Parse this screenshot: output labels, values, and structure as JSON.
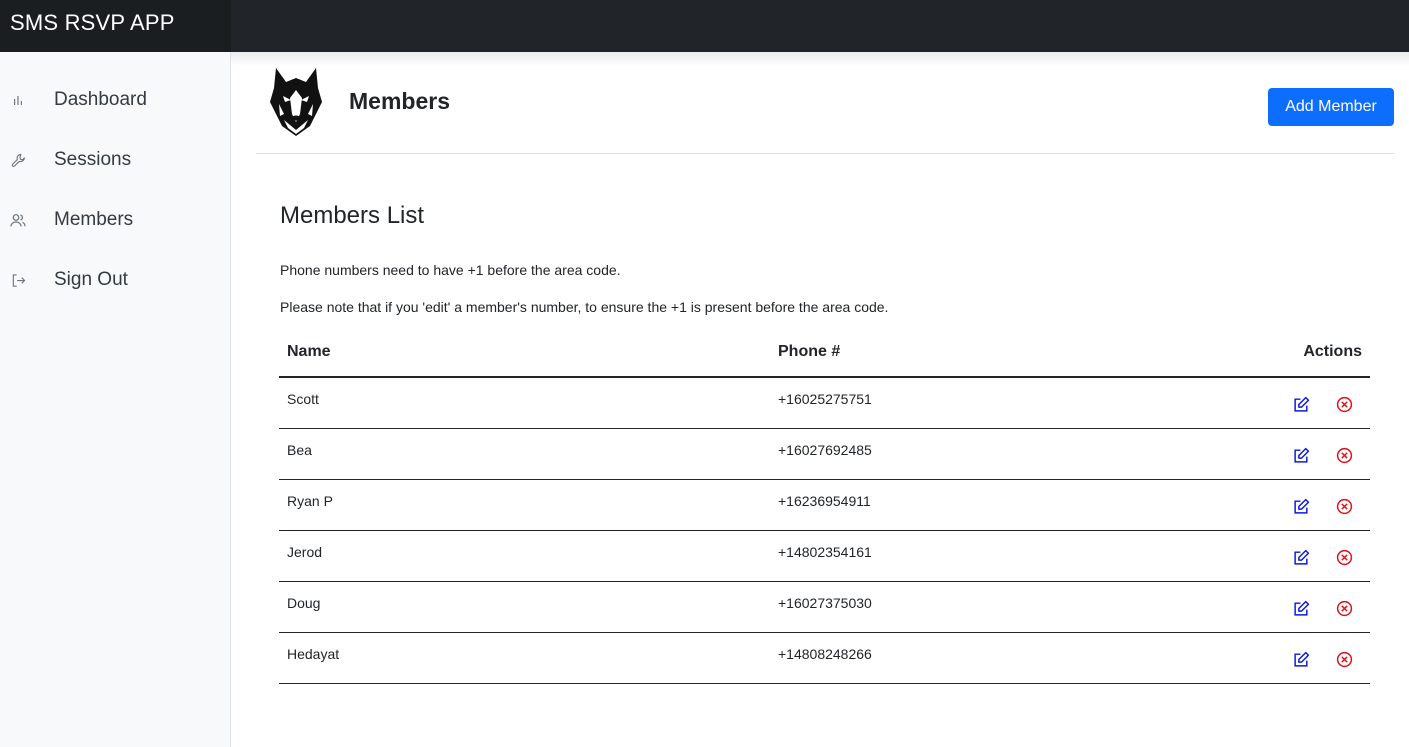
{
  "app": {
    "title": "SMS RSVP APP"
  },
  "sidebar": {
    "items": [
      {
        "label": "Dashboard",
        "icon": "bar-chart-icon"
      },
      {
        "label": "Sessions",
        "icon": "wrench-icon"
      },
      {
        "label": "Members",
        "icon": "users-icon"
      },
      {
        "label": "Sign Out",
        "icon": "sign-out-icon"
      }
    ]
  },
  "header": {
    "title": "Members",
    "add_button": "Add Member",
    "logo_icon": "wolf-logo-icon"
  },
  "main": {
    "section_title": "Members List",
    "notes": [
      "Phone numbers need to have +1 before the area code.",
      "Please note that if you 'edit' a member's number, to ensure the +1 is present before the area code."
    ],
    "table": {
      "columns": [
        "Name",
        "Phone #",
        "Actions"
      ],
      "rows": [
        {
          "name": "Scott",
          "phone": "+16025275751"
        },
        {
          "name": "Bea",
          "phone": "+16027692485"
        },
        {
          "name": "Ryan P",
          "phone": "+16236954911"
        },
        {
          "name": "Jerod",
          "phone": "+14802354161"
        },
        {
          "name": "Doug",
          "phone": "+16027375030"
        },
        {
          "name": "Hedayat",
          "phone": "+14808248266"
        }
      ]
    }
  },
  "colors": {
    "topbar": "#212529",
    "primary": "#0d6efd",
    "edit": "#0d1bdb",
    "delete": "#e0101a"
  }
}
